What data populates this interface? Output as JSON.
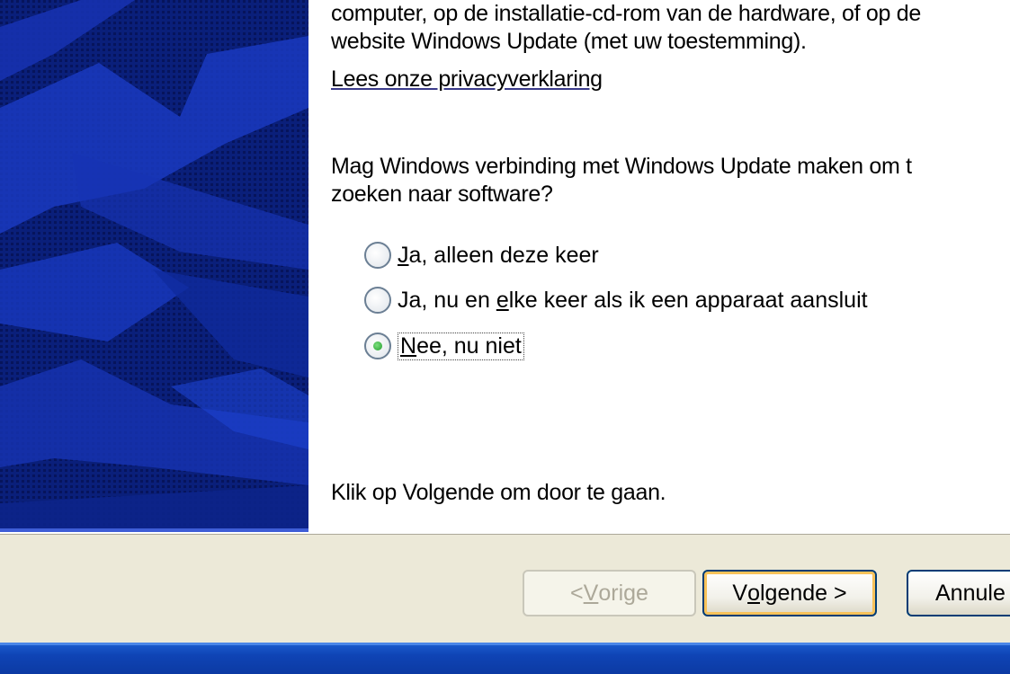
{
  "content": {
    "line1": "computer, op de installatie-cd-rom van de hardware, of op de",
    "line2": "website Windows Update (met uw toestemming).",
    "privacy_link": "Lees onze privacyverklaring",
    "question_line1": "Mag Windows verbinding met Windows Update maken om t",
    "question_line2": "zoeken naar software?",
    "options": [
      {
        "accel": "J",
        "rest": "a, alleen deze keer",
        "checked": false
      },
      {
        "before": "Ja, nu en ",
        "accel": "e",
        "after": "lke keer als ik een apparaat aansluit",
        "checked": false
      },
      {
        "accel": "N",
        "rest": "ee, nu niet",
        "checked": true
      }
    ],
    "continue_text": "Klik op Volgende om door te gaan."
  },
  "buttons": {
    "back_pre": "< ",
    "back_accel": "V",
    "back_post": "orige",
    "next_pre": "V",
    "next_accel": "o",
    "next_post": "lgende >",
    "cancel": "Annule"
  },
  "colors": {
    "panel_blue": "#0a1f7a",
    "footer_gray": "#ece9d8",
    "taskbar_blue": "#0f44b5",
    "default_button_glow": "#f7c25a",
    "radio_dot": "#1f9c2b"
  }
}
